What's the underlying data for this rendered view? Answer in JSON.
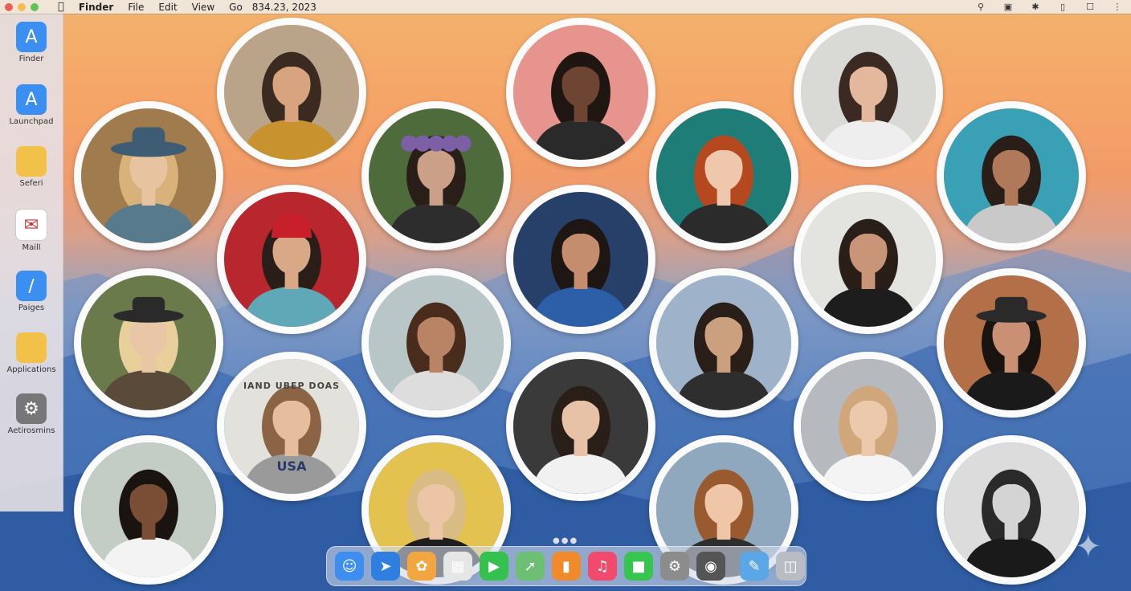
{
  "menubar": {
    "app_name": "Finder",
    "menus": [
      "File",
      "Edit",
      "View",
      "Go"
    ],
    "date": "834.23, 2023",
    "apple_icon": "apple-icon",
    "status_icons": [
      "search-icon",
      "screenshot-icon",
      "bluetooth-icon",
      "battery-icon",
      "spotlight-icon",
      "control-center-icon"
    ]
  },
  "sidebar": {
    "items": [
      {
        "label": "Finder",
        "icon": "app-store-icon",
        "color": "#3a8ff0"
      },
      {
        "label": "Launchpad",
        "icon": "app-store-icon",
        "color": "#3a8ff0"
      },
      {
        "label": "Seferi",
        "icon": "folder-icon",
        "color": "#f2c14a"
      },
      {
        "label": "Maill",
        "icon": "mail-icon",
        "color": "#ffffff"
      },
      {
        "label": "Paiges",
        "icon": "pages-icon",
        "color": "#3a8ff0"
      },
      {
        "label": "Applications",
        "icon": "folder-icon",
        "color": "#f2c14a"
      },
      {
        "label": "Aetirosmins",
        "icon": "settings-icon",
        "color": "#777777"
      }
    ]
  },
  "photo_grid": {
    "shirt_text": "USA",
    "sign_text": "IAND UBEP DOAS",
    "people": [
      {
        "name": "portrait-woman-yellow-blouse",
        "bg": "#b9a48a",
        "skin": "#d7a47f",
        "hair": "#3a2a20",
        "shirt": "#c8932e"
      },
      {
        "name": "portrait-woman-pink-wall",
        "bg": "#e7948e",
        "skin": "#6e4533",
        "hair": "#1f1612",
        "shirt": "#2a2a2a"
      },
      {
        "name": "portrait-woman-white-top",
        "bg": "#d9d9d6",
        "skin": "#e4b89c",
        "hair": "#3b2a22",
        "shirt": "#eeeeee"
      },
      {
        "name": "portrait-woman-blue-hat",
        "bg": "#9f7b4d",
        "skin": "#e7c3a0",
        "hair": "#d8b27a",
        "shirt": "#577a8c"
      },
      {
        "name": "portrait-woman-flower-crown",
        "bg": "#4d6b3b",
        "skin": "#caa088",
        "hair": "#2a1e18",
        "shirt": "#2d2d2d"
      },
      {
        "name": "portrait-woman-red-hair",
        "bg": "#1f7d78",
        "skin": "#efc7ad",
        "hair": "#b5481e",
        "shirt": "#2b2b2b"
      },
      {
        "name": "portrait-woman-beach-fence",
        "bg": "#3aa0b5",
        "skin": "#b07a5a",
        "hair": "#2a1e18",
        "shirt": "#c9c9c9"
      },
      {
        "name": "portrait-woman-red-beanie",
        "bg": "#b8262e",
        "skin": "#d9a887",
        "hair": "#2a1e18",
        "shirt": "#5ea8b8"
      },
      {
        "name": "portrait-woman-polka-dot",
        "bg": "#26406a",
        "skin": "#c48d6e",
        "hair": "#1e1612",
        "shirt": "#2c5fa8"
      },
      {
        "name": "portrait-woman-black-top",
        "bg": "#e3e3e0",
        "skin": "#c99578",
        "hair": "#2a1e18",
        "shirt": "#1d1d1d"
      },
      {
        "name": "portrait-woman-black-hat",
        "bg": "#6b7a4b",
        "skin": "#e8c6a6",
        "hair": "#e8d09a",
        "shirt": "#5a4a3a"
      },
      {
        "name": "portrait-woman-curly-hair",
        "bg": "#b9c6c7",
        "skin": "#b98466",
        "hair": "#4a2c1c",
        "shirt": "#dddddd"
      },
      {
        "name": "portrait-woman-city-tracks",
        "bg": "#9eb3c9",
        "skin": "#caa07f",
        "hair": "#2a1e18",
        "shirt": "#2e2e2e"
      },
      {
        "name": "portrait-woman-black-hat-brown-wall",
        "bg": "#b36f47",
        "skin": "#c99073",
        "hair": "#1a1410",
        "shirt": "#1a1a1a"
      },
      {
        "name": "portrait-woman-usa-shirt",
        "bg": "#e3e1dc",
        "skin": "#e6bd9d",
        "hair": "#8a6444",
        "shirt": "#9a9a9a"
      },
      {
        "name": "portrait-woman-off-shoulder",
        "bg": "#3a3a3a",
        "skin": "#e8c2a6",
        "hair": "#2a1e18",
        "shirt": "#f1f1f1"
      },
      {
        "name": "portrait-woman-white-dress",
        "bg": "#b6b9be",
        "skin": "#ecc9ad",
        "hair": "#cfa77a",
        "shirt": "#f4f4f4"
      },
      {
        "name": "portrait-woman-afro",
        "bg": "#c3cdc4",
        "skin": "#7a4d35",
        "hair": "#1a1410",
        "shirt": "#f3f3f3"
      },
      {
        "name": "portrait-woman-blonde-yellow",
        "bg": "#e3c24f",
        "skin": "#ecc5a6",
        "hair": "#d9bc84",
        "shirt": "#1e1e1e"
      },
      {
        "name": "portrait-woman-bob-hair",
        "bg": "#8fa8bd",
        "skin": "#efc6a8",
        "hair": "#9a5a30",
        "shirt": "#2e2e2e"
      },
      {
        "name": "portrait-woman-black-white",
        "bg": "#dcdcdc",
        "skin": "#d4d4d4",
        "hair": "#2a2a2a",
        "shirt": "#1a1a1a"
      }
    ]
  },
  "dock": {
    "items": [
      {
        "name": "finder-icon",
        "color": "#3d8ef0"
      },
      {
        "name": "safari-icon",
        "color": "#2f7fe0"
      },
      {
        "name": "photos-icon",
        "color": "#f2a640"
      },
      {
        "name": "launchpad-icon",
        "color": "#e6e6e6"
      },
      {
        "name": "facetime-icon",
        "color": "#35c14d"
      },
      {
        "name": "maps-icon",
        "color": "#6dbf73"
      },
      {
        "name": "books-icon",
        "color": "#f08a2b"
      },
      {
        "name": "music-icon",
        "color": "#f24a6c"
      },
      {
        "name": "messages-icon",
        "color": "#36c64f"
      },
      {
        "name": "system-settings-icon",
        "color": "#8c8c8c"
      },
      {
        "name": "camera-icon",
        "color": "#555555"
      },
      {
        "name": "preview-icon",
        "color": "#5aa6e6"
      },
      {
        "name": "trash-icon",
        "color": "#b9bcc2"
      }
    ]
  }
}
